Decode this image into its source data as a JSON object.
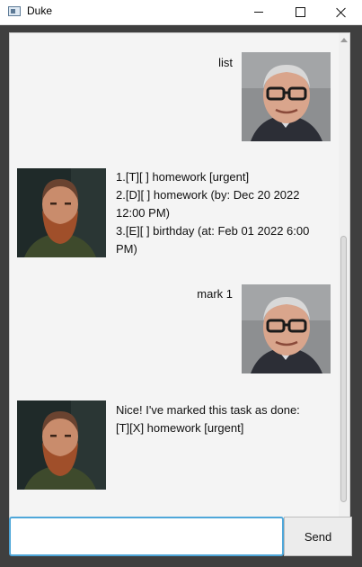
{
  "window": {
    "title": "Duke"
  },
  "dialog": [
    {
      "speaker": "user",
      "text": "list"
    },
    {
      "speaker": "duke",
      "text": "1.[T][ ] homework [urgent]\n2.[D][ ] homework (by: Dec 20 2022\n12:00 PM)\n3.[E][ ] birthday (at: Feb 01 2022 6:00\nPM)"
    },
    {
      "speaker": "user",
      "text": "mark 1"
    },
    {
      "speaker": "duke",
      "text": "Nice! I've marked this task as done:\n[T][X] homework [urgent]"
    }
  ],
  "input": {
    "value": "",
    "send_label": "Send"
  },
  "colors": {
    "dialog_bg": "#f4f4f4",
    "input_focus": "#4fa7d9",
    "frame_bg": "#3f3f3f"
  }
}
